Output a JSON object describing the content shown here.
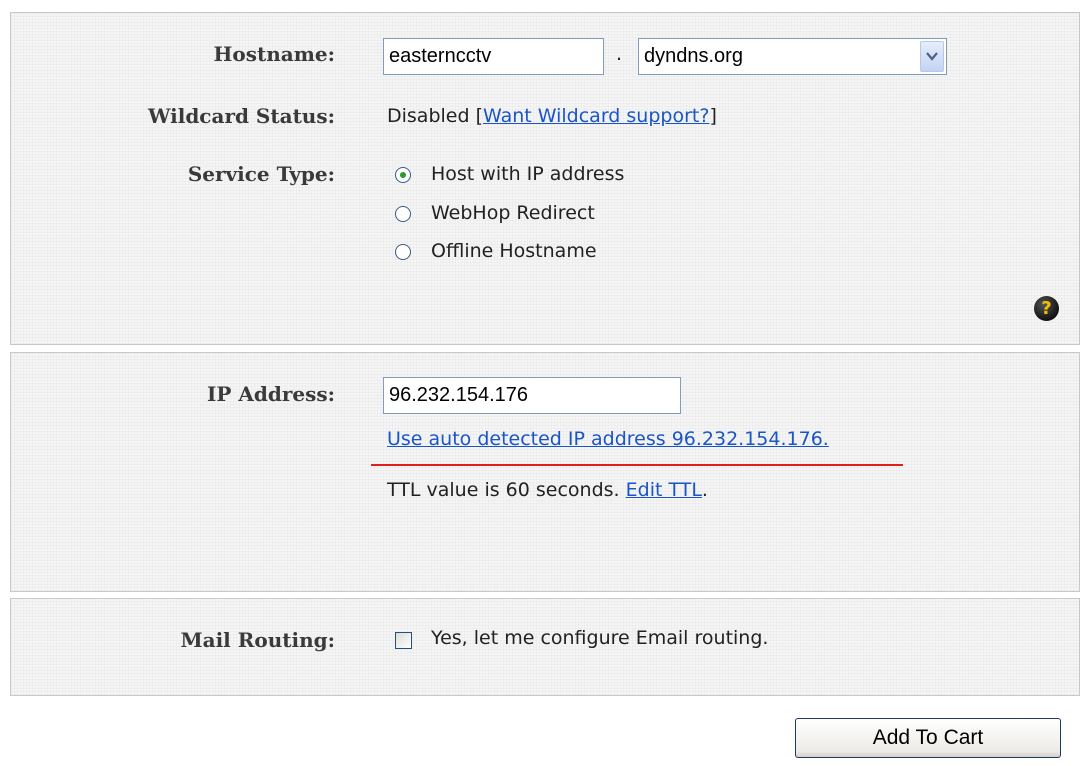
{
  "hostname": {
    "label": "Hostname:",
    "value": "easterncctv",
    "separator": ".",
    "domain_selected": "dyndns.org"
  },
  "wildcard": {
    "label": "Wildcard Status:",
    "status_prefix": "Disabled [",
    "link_text": "Want Wildcard support?",
    "status_suffix": "]"
  },
  "service_type": {
    "label": "Service Type:",
    "options": [
      {
        "label": "Host with IP address",
        "selected": true
      },
      {
        "label": "WebHop Redirect",
        "selected": false
      },
      {
        "label": "Offline Hostname",
        "selected": false
      }
    ],
    "help_icon": "help-question-icon",
    "help_glyph": "?"
  },
  "ip": {
    "label": "IP Address:",
    "value": "96.232.154.176",
    "auto_detect_link": "Use auto detected IP address 96.232.154.176.",
    "ttl_text": "TTL value is 60 seconds. ",
    "edit_ttl_link": "Edit TTL",
    "ttl_suffix": "."
  },
  "mail": {
    "label": "Mail Routing:",
    "checkbox_label": "Yes, let me configure Email routing.",
    "checked": false
  },
  "actions": {
    "add_to_cart": "Add To Cart"
  },
  "colors": {
    "link": "#1a55c8",
    "annotation_underline": "#e02020",
    "radio_dot": "#2a9a2a"
  }
}
